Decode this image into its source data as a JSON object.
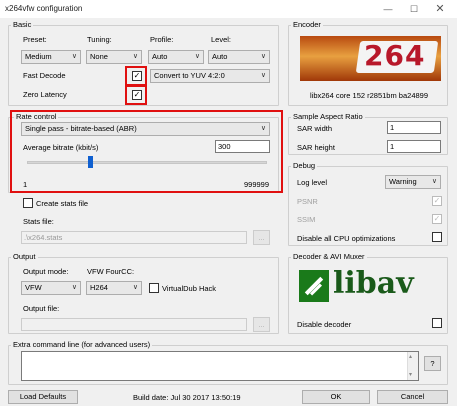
{
  "window": {
    "title": "x264vfw configuration",
    "minimize_icon": "minimize-icon",
    "maximize_icon": "maximize-icon",
    "close_icon": "close-icon"
  },
  "basic": {
    "group_label": "Basic",
    "preset_label": "Preset:",
    "tuning_label": "Tuning:",
    "profile_label": "Profile:",
    "level_label": "Level:",
    "preset_value": "Medium",
    "tuning_value": "None",
    "profile_value": "Auto",
    "level_value": "Auto",
    "fast_decode_label": "Fast Decode",
    "fast_decode_checked": "✓",
    "zero_latency_label": "Zero Latency",
    "zero_latency_checked": "✓",
    "convert_value": "Convert to YUV 4:2:0"
  },
  "encoder": {
    "group_label": "Encoder",
    "logo_text": "264",
    "version": "libx264 core 152 r2851bm ba24899"
  },
  "rate_control": {
    "group_label": "Rate control",
    "mode_value": "Single pass - bitrate-based (ABR)",
    "bitrate_label": "Average bitrate (kbit/s)",
    "bitrate_value": "300",
    "slider_fraction": 0.0003,
    "min_label": "1",
    "max_label": "999999"
  },
  "stats": {
    "create_label": "Create stats file",
    "file_label": "Stats file:",
    "file_value": ".\\x264.stats",
    "browse": "..."
  },
  "sar": {
    "group_label": "Sample Aspect Ratio",
    "width_label": "SAR width",
    "width_value": "1",
    "height_label": "SAR height",
    "height_value": "1"
  },
  "debug": {
    "group_label": "Debug",
    "log_level_label": "Log level",
    "log_level_value": "Warning",
    "psnr_label": "PSNR",
    "ssim_label": "SSIM",
    "check_mark": "✓",
    "disable_cpu_label": "Disable all CPU optimizations"
  },
  "output": {
    "group_label": "Output",
    "mode_label": "Output mode:",
    "fourcc_label": "VFW FourCC:",
    "mode_value": "VFW",
    "fourcc_value": "H264",
    "vdub_label": "VirtualDub Hack",
    "file_label": "Output file:",
    "browse": "..."
  },
  "muxer": {
    "group_label": "Decoder & AVI Muxer",
    "logo_text": "libav",
    "disable_decoder_label": "Disable decoder"
  },
  "extra": {
    "group_label": "Extra command line (for advanced users)",
    "help": "?"
  },
  "footer": {
    "load_defaults": "Load Defaults",
    "build_date": "Build date: Jul 30 2017 13:50:19",
    "ok": "OK",
    "cancel": "Cancel"
  },
  "colors": {
    "highlight_border": "#e01010",
    "slider_thumb": "#1060d0",
    "libav_green": "#1a7a1a"
  }
}
